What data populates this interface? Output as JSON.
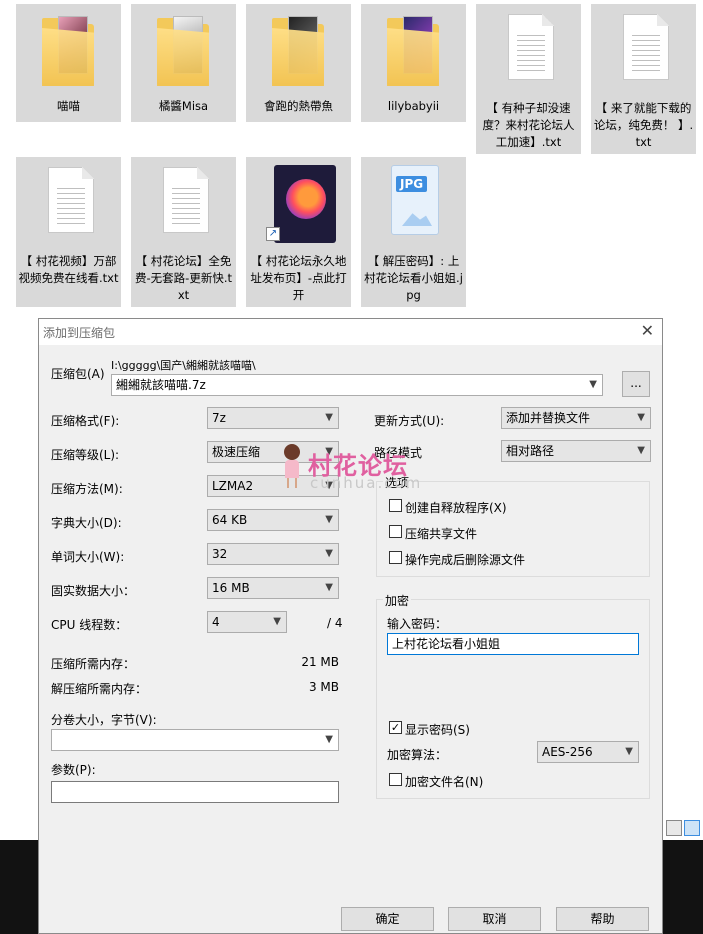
{
  "explorer": {
    "items": [
      {
        "label": "喵喵",
        "type": "folder"
      },
      {
        "label": "橘醬Misa",
        "type": "folder"
      },
      {
        "label": "會跑的熱帶魚",
        "type": "folder"
      },
      {
        "label": "lilybabyii",
        "type": "folder"
      },
      {
        "label": "【 有种子却没速度？来村花论坛人工加速】.txt",
        "type": "txt"
      },
      {
        "label": "【 来了就能下载的论坛，纯免费！ 】.txt",
        "type": "txt"
      },
      {
        "label": "【 村花视频】万部视频免费在线看.txt",
        "type": "txt"
      },
      {
        "label": "【 村花论坛】全免费-无套路-更新快.txt",
        "type": "txt"
      },
      {
        "label": "【 村花论坛永久地址发布页】-点此打开",
        "type": "shortcut"
      },
      {
        "label": "【 解压密码】: 上村花论坛看小姐姐.jpg",
        "type": "jpg"
      }
    ],
    "jpg_badge": "JPG"
  },
  "dialog": {
    "title": "添加到压缩包",
    "close": "✕",
    "archive_label": "压缩包(A)",
    "archive_path": "I:\\ggggg\\国产\\緗緗就該喵喵\\",
    "archive_name": "緗緗就該喵喵.7z",
    "browse_label": "...",
    "format_label": "压缩格式(F):",
    "format_value": "7z",
    "level_label": "压缩等级(L):",
    "level_value": "极速压缩",
    "method_label": "压缩方法(M):",
    "method_value": "LZMA2",
    "dict_label": "字典大小(D):",
    "dict_value": "64 KB",
    "word_label": "单词大小(W):",
    "word_value": "32",
    "solid_label": "固实数据大小：",
    "solid_value": "16 MB",
    "cpu_label": "CPU 线程数：",
    "cpu_value": "4",
    "cpu_total": "/ 4",
    "mem_comp_label": "压缩所需内存：",
    "mem_comp_value": "21 MB",
    "mem_decomp_label": "解压缩所需内存：",
    "mem_decomp_value": "3 MB",
    "split_label": "分卷大小，字节(V):",
    "split_value": "",
    "params_label": "参数(P):",
    "params_value": "",
    "update_label": "更新方式(U):",
    "update_value": "添加并替换文件",
    "path_label": "路径模式",
    "path_value": "相对路径",
    "options_title": "选项",
    "opt_sfx": "创建自释放程序(X)",
    "opt_shared": "压缩共享文件",
    "opt_delete": "操作完成后删除源文件",
    "enc_title": "加密",
    "enc_pwd_label": "输入密码：",
    "enc_pwd_value": "上村花论坛看小姐姐",
    "enc_show": "显示密码(S)",
    "enc_method_label": "加密算法：",
    "enc_method_value": "AES-256",
    "enc_names": "加密文件名(N)",
    "check_mark": "✓",
    "ok": "确定",
    "cancel": "取消",
    "help": "帮助"
  },
  "watermark": {
    "text": "村花论坛",
    "sub": "cunhua.com"
  },
  "colors": {
    "folder": "#f3c95a",
    "selection": "#d9d9d9",
    "dialog_bg": "#f0f0f0",
    "focus_border": "#0078d7",
    "watermark": "#e060a0"
  }
}
